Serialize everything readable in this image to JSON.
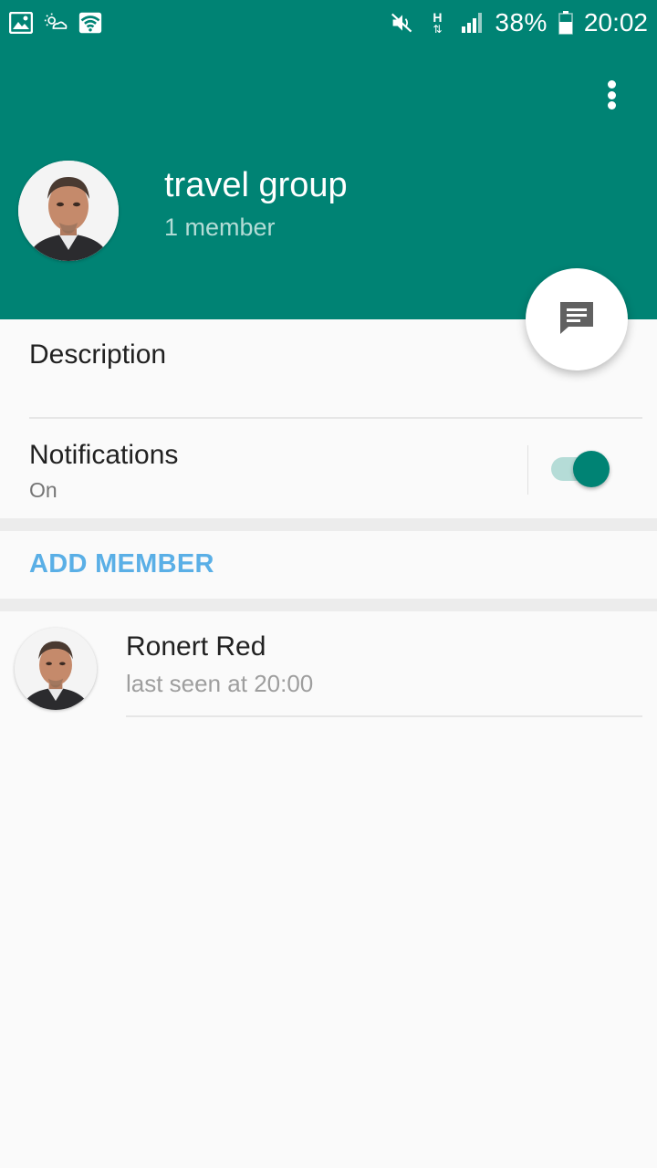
{
  "status_bar": {
    "battery_percent": "38%",
    "time": "20:02",
    "network_label": "H",
    "icons": [
      "gallery-icon",
      "weather-icon",
      "wifi-icon",
      "mute-icon",
      "network-type-icon",
      "signal-icon",
      "battery-icon"
    ]
  },
  "header": {
    "group_name": "travel group",
    "member_count": "1 member",
    "background_color": "#008374",
    "avatar": "profile-photo"
  },
  "description": {
    "label": "Description"
  },
  "notifications": {
    "label": "Notifications",
    "state": "On",
    "enabled": true
  },
  "add_member": {
    "label": "ADD MEMBER"
  },
  "members": [
    {
      "name": "Ronert Red",
      "status": "last seen at 20:00"
    }
  ]
}
